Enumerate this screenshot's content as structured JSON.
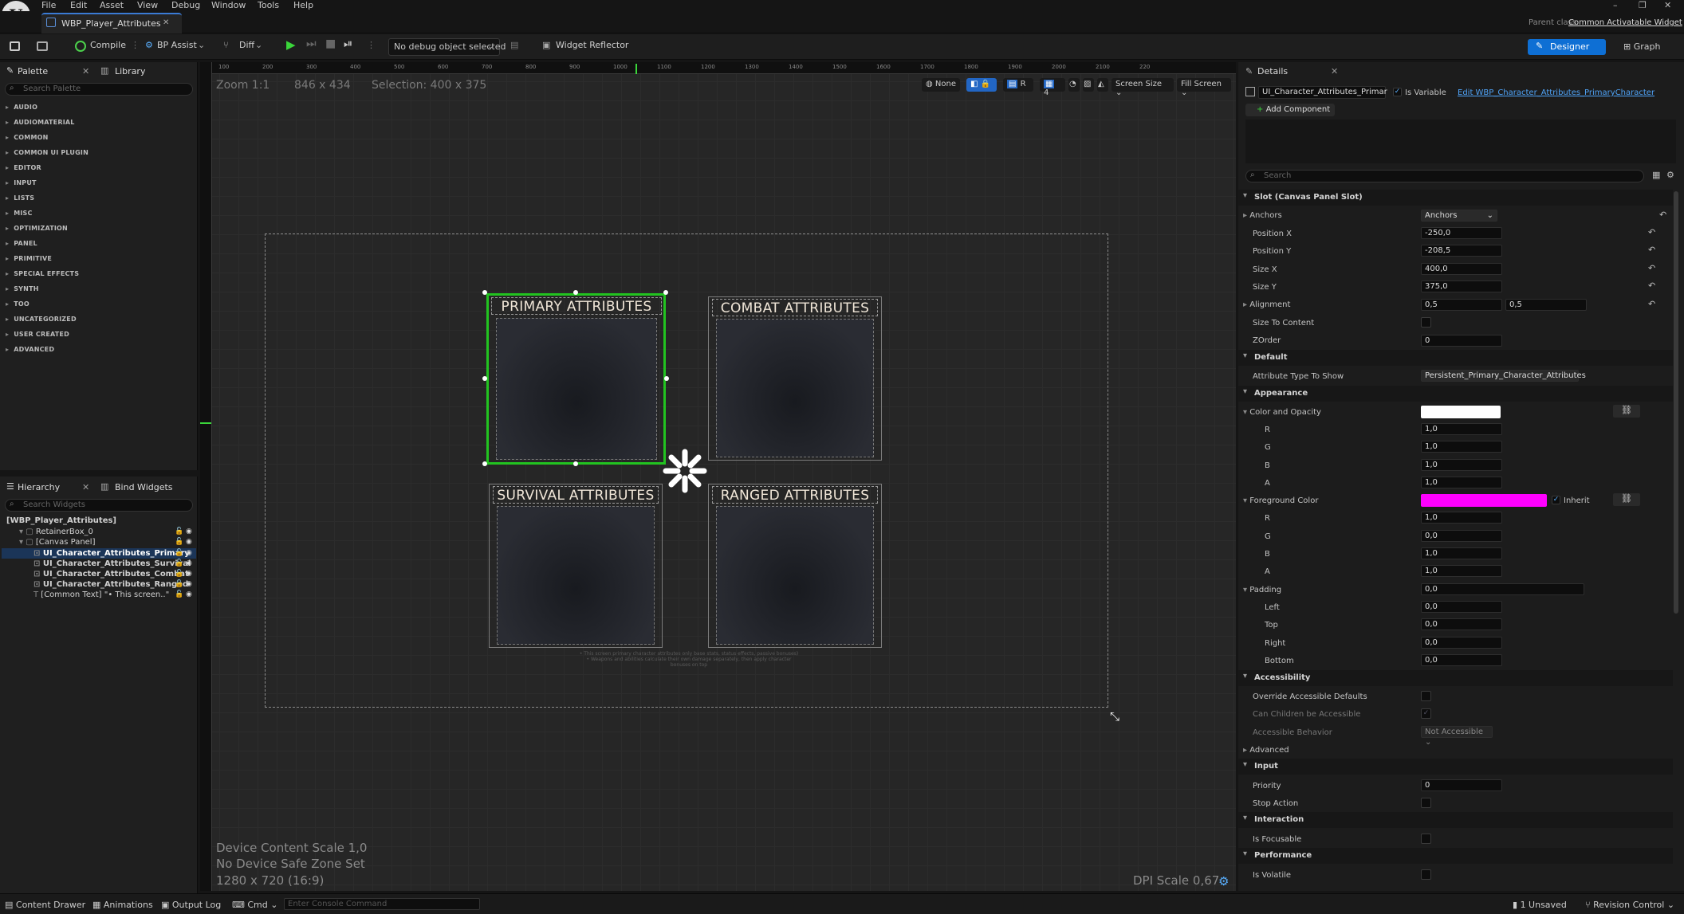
{
  "menu": [
    "File",
    "Edit",
    "Asset",
    "View",
    "Debug",
    "Window",
    "Tools",
    "Help"
  ],
  "window_controls": [
    "–",
    "❐",
    "✕"
  ],
  "doc_tab": {
    "label": "WBP_Player_Attributes",
    "close": "✕"
  },
  "parent_class": {
    "label": "Parent class:",
    "value": "Common Activatable Widget"
  },
  "toolbar": {
    "compile": "Compile",
    "bp_assist": "BP Assist",
    "diff": "Diff",
    "debug_select": "No debug object selected",
    "widget_reflector": "Widget Reflector",
    "designer": "Designer",
    "graph": "Graph"
  },
  "palette": {
    "tab": "Palette",
    "library_tab": "Library",
    "search_placeholder": "Search Palette",
    "categories": [
      "AUDIO",
      "AUDIOMATERIAL",
      "COMMON",
      "COMMON UI PLUGIN",
      "EDITOR",
      "INPUT",
      "LISTS",
      "MISC",
      "OPTIMIZATION",
      "PANEL",
      "PRIMITIVE",
      "SPECIAL EFFECTS",
      "SYNTH",
      "TOO",
      "UNCATEGORIZED",
      "USER CREATED",
      "ADVANCED"
    ]
  },
  "hierarchy": {
    "tab": "Hierarchy",
    "bind_tab": "Bind Widgets",
    "search_placeholder": "Search Widgets",
    "rows": [
      "[WBP_Player_Attributes]",
      "RetainerBox_0",
      "[Canvas Panel]",
      "UI_Character_Attributes_Primary",
      "UI_Character_Attributes_Survival",
      "UI_Character_Attributes_Combat",
      "UI_Character_Attributes_Ranged",
      "[Common Text] \"• This screen..\""
    ]
  },
  "viewport": {
    "zoom": "Zoom 1:1",
    "size": "846 x 434",
    "selection": "Selection: 400 x 375",
    "none_btn": "None",
    "r_btn": "R",
    "grid_num": "4",
    "screen_size": "Screen Size",
    "fill_screen": "Fill Screen",
    "ruler_ticks": [
      "100",
      "200",
      "300",
      "400",
      "500",
      "600",
      "700",
      "800",
      "900",
      "1000",
      "1100",
      "1200",
      "1300",
      "1400",
      "1500",
      "1600",
      "1700",
      "1800",
      "1900",
      "2000",
      "2100",
      "220"
    ],
    "device_scale": "Device Content Scale 1,0",
    "safe_zone": "No Device Safe Zone Set",
    "resolution": "1280 x 720 (16:9)",
    "dpi": "DPI Scale 0,67",
    "cards": {
      "primary": "PRIMARY ATTRIBUTES",
      "combat": "COMBAT ATTRIBUTES",
      "survival": "SURVIVAL ATTRIBUTES",
      "ranged": "RANGED ATTRIBUTES"
    },
    "caption_lines": [
      "• This screen primary character attributes only base stats, status effects, passive bonuses)",
      "• Weapons and abilities calculate their own damage separately, then apply character bonuses on top"
    ]
  },
  "details": {
    "tab": "Details",
    "widget_name": "UI_Character_Attributes_Primar",
    "is_variable": "Is Variable",
    "edit_link": "Edit WBP_Character_Attributes_PrimaryCharacter",
    "add_component": "Add Component",
    "search_placeholder": "Search",
    "slot_section": "Slot (Canvas Panel Slot)",
    "anchors_label": "Anchors",
    "anchors_value": "Anchors",
    "position_x_label": "Position X",
    "position_x": "-250,0",
    "position_y_label": "Position Y",
    "position_y": "-208,5",
    "size_x_label": "Size X",
    "size_x": "400,0",
    "size_y_label": "Size Y",
    "size_y": "375,0",
    "alignment_label": "Alignment",
    "alignment_x": "0,5",
    "alignment_y": "0,5",
    "size_to_content": "Size To Content",
    "zorder_label": "ZOrder",
    "zorder": "0",
    "default_section": "Default",
    "attr_type_label": "Attribute Type To Show",
    "attr_type_value": "Persistent_Primary_Character_Attributes",
    "appearance_section": "Appearance",
    "color_opacity": "Color and Opacity",
    "co_r_label": "R",
    "co_r": "1,0",
    "co_g_label": "G",
    "co_g": "1,0",
    "co_b_label": "B",
    "co_b": "1,0",
    "co_a_label": "A",
    "co_a": "1,0",
    "foreground": "Foreground Color",
    "inherit": "Inherit",
    "fg_r_label": "R",
    "fg_r": "1,0",
    "fg_g_label": "G",
    "fg_g": "0,0",
    "fg_b_label": "B",
    "fg_b": "1,0",
    "fg_a_label": "A",
    "fg_a": "1,0",
    "padding_label": "Padding",
    "padding": "0,0",
    "left_label": "Left",
    "left": "0,0",
    "top_label": "Top",
    "top": "0,0",
    "right_label": "Right",
    "right": "0,0",
    "bottom_label": "Bottom",
    "bottom": "0,0",
    "accessibility_section": "Accessibility",
    "override_access": "Override Accessible Defaults",
    "children_access": "Can Children be Accessible",
    "access_behavior": "Accessible Behavior",
    "access_behavior_value": "Not Accessible",
    "advanced": "Advanced",
    "input_section": "Input",
    "priority_label": "Priority",
    "priority": "0",
    "stop_action": "Stop Action",
    "interaction_section": "Interaction",
    "is_focusable": "Is Focusable",
    "performance_section": "Performance",
    "is_volatile": "Is Volatile"
  },
  "colors": {
    "color_opacity": "#ffffff",
    "foreground": "#ff00ff",
    "accent": "#0e6fd4",
    "selection": "#22c320"
  },
  "bottom": {
    "content_drawer": "Content Drawer",
    "animations": "Animations",
    "output_log": "Output Log",
    "cmd": "Cmd",
    "console_placeholder": "Enter Console Command",
    "unsaved": "1 Unsaved",
    "revision": "Revision Control"
  }
}
